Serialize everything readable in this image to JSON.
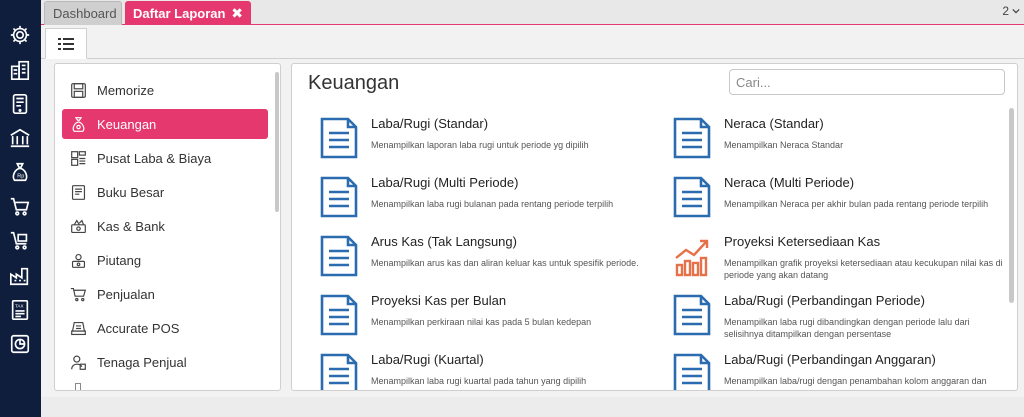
{
  "tabs": [
    {
      "label": "Dashboard"
    },
    {
      "label": "Daftar Laporan",
      "close": "✖"
    }
  ],
  "tab_count": "2",
  "rail_icons": [
    "gear-icon",
    "building-icon",
    "tablet-icon",
    "bank-icon",
    "money-bag-icon",
    "cart-icon",
    "cart-box-icon",
    "factory-icon",
    "tax-icon",
    "report-icon"
  ],
  "categories": [
    {
      "label": "Memorize",
      "icon": "save-icon"
    },
    {
      "label": "Keuangan",
      "icon": "money-bag-icon",
      "active": true
    },
    {
      "label": "Pusat Laba & Biaya",
      "icon": "cost-center-icon"
    },
    {
      "label": "Buku Besar",
      "icon": "ledger-icon"
    },
    {
      "label": "Kas & Bank",
      "icon": "cash-icon"
    },
    {
      "label": "Piutang",
      "icon": "receivable-icon"
    },
    {
      "label": "Penjualan",
      "icon": "cart-icon"
    },
    {
      "label": "Accurate POS",
      "icon": "pos-icon"
    },
    {
      "label": "Tenaga Penjual",
      "icon": "salesperson-icon"
    }
  ],
  "main": {
    "title": "Keuangan",
    "search_placeholder": "Cari...",
    "reports": [
      {
        "title": "Laba/Rugi (Standar)",
        "desc": "Menampilkan laporan laba rugi untuk periode yg dipilih",
        "icon": "document-icon"
      },
      {
        "title": "Neraca (Standar)",
        "desc": "Menampilkan Neraca Standar",
        "icon": "document-icon"
      },
      {
        "title": "Laba/Rugi (Multi Periode)",
        "desc": "Menampilkan laba rugi bulanan pada rentang periode terpilih",
        "icon": "document-icon"
      },
      {
        "title": "Neraca (Multi Periode)",
        "desc": "Menampilkan Neraca per akhir bulan pada rentang periode terpilih",
        "icon": "document-icon"
      },
      {
        "title": "Arus Kas (Tak Langsung)",
        "desc": "Menampilkan arus kas dan aliran keluar kas untuk spesifik periode.",
        "icon": "document-icon"
      },
      {
        "title": "Proyeksi Ketersediaan Kas",
        "desc": "Menampilkan grafik proyeksi ketersediaan atau kecukupan nilai kas di periode yang akan datang",
        "icon": "growth-chart-icon"
      },
      {
        "title": "Proyeksi Kas per Bulan",
        "desc": "Menampilkan perkiraan nilai kas pada 5 bulan kedepan",
        "icon": "document-icon"
      },
      {
        "title": "Laba/Rugi (Perbandingan Periode)",
        "desc": "Menampilkan laba rugi dibandingkan dengan periode lalu dari selisihnya ditampilkan dengan persentase",
        "icon": "document-icon"
      },
      {
        "title": "Laba/Rugi (Kuartal)",
        "desc": "Menampilkan laba rugi kuartal pada tahun yang dipilih",
        "icon": "document-icon"
      },
      {
        "title": "Laba/Rugi (Perbandingan Anggaran)",
        "desc": "Menampilkan laba/rugi dengan penambahan kolom anggaran dan",
        "icon": "document-icon"
      }
    ]
  },
  "colors": {
    "accent": "#e5386e",
    "rail": "#0f1e3d",
    "doc_icon": "#2b6cb0",
    "chart_icon": "#e5704a"
  }
}
